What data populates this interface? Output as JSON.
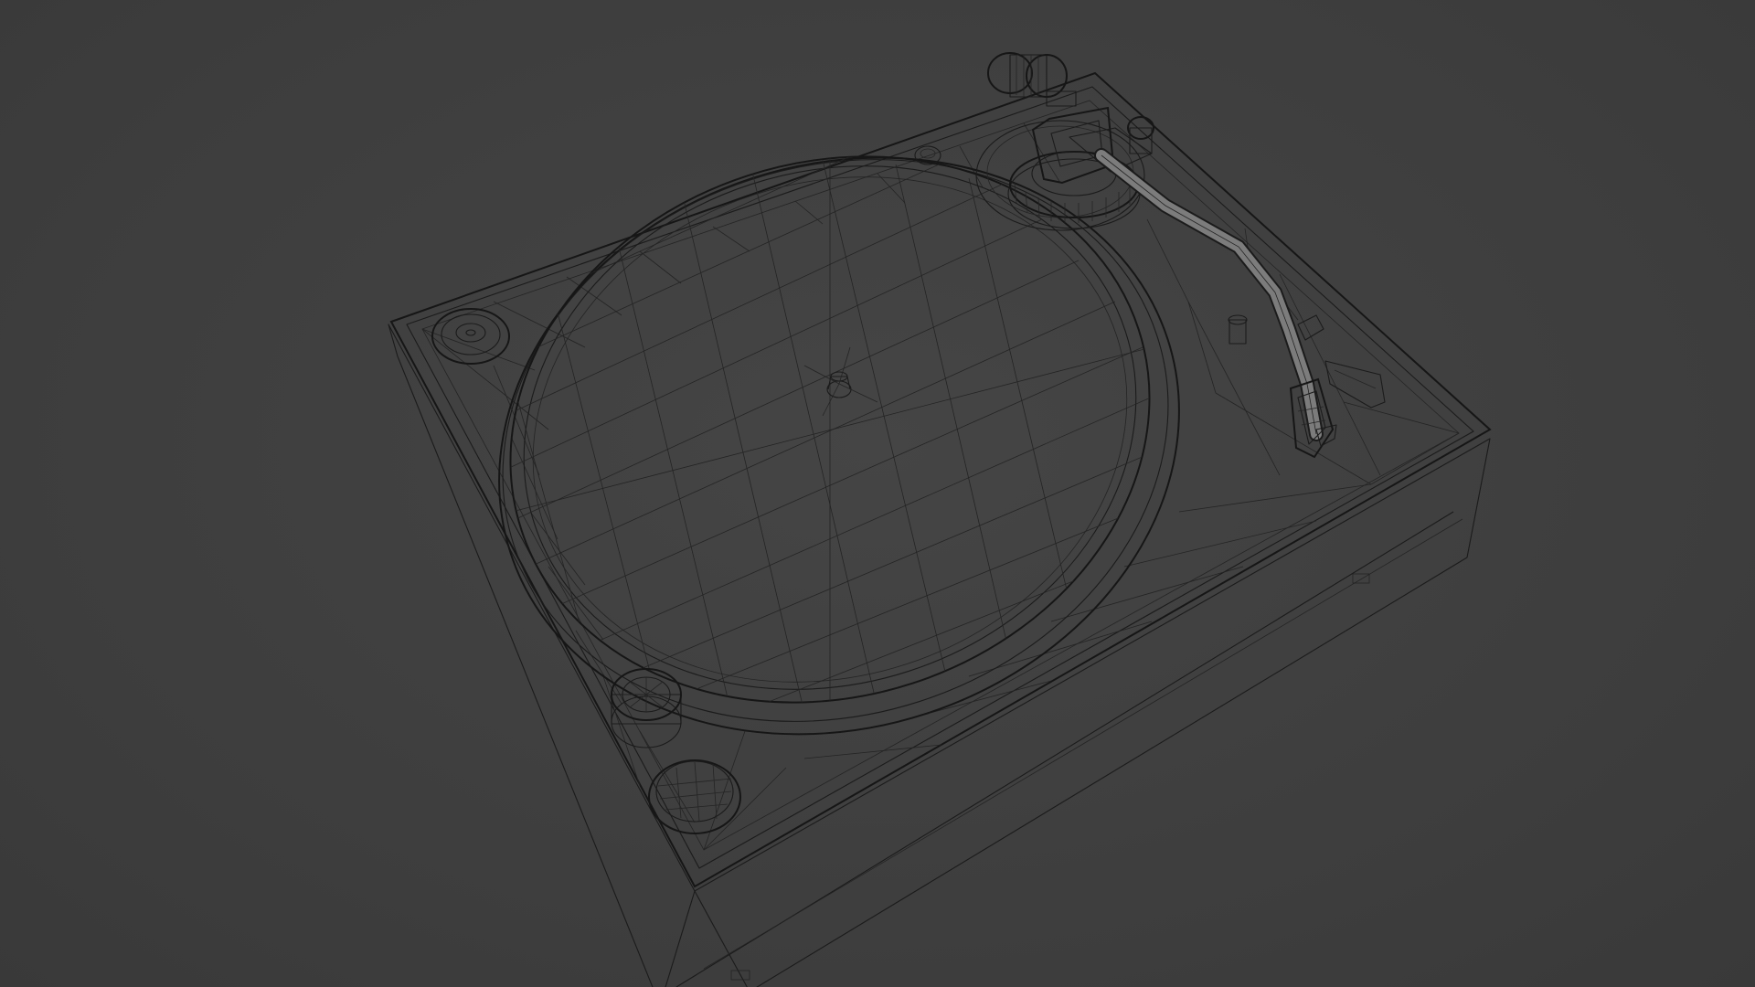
{
  "scene": {
    "subject": "turntable-3d-model",
    "view_mode": "wireframe-over-solid",
    "colors": {
      "background": "#3f3f3f",
      "surface_top": "#7a7a7a",
      "surface_side_dark": "#474747",
      "surface_side_mid": "#5a5a5a",
      "platter": "#7e7e7e",
      "wire": "#1b1b1b"
    }
  }
}
